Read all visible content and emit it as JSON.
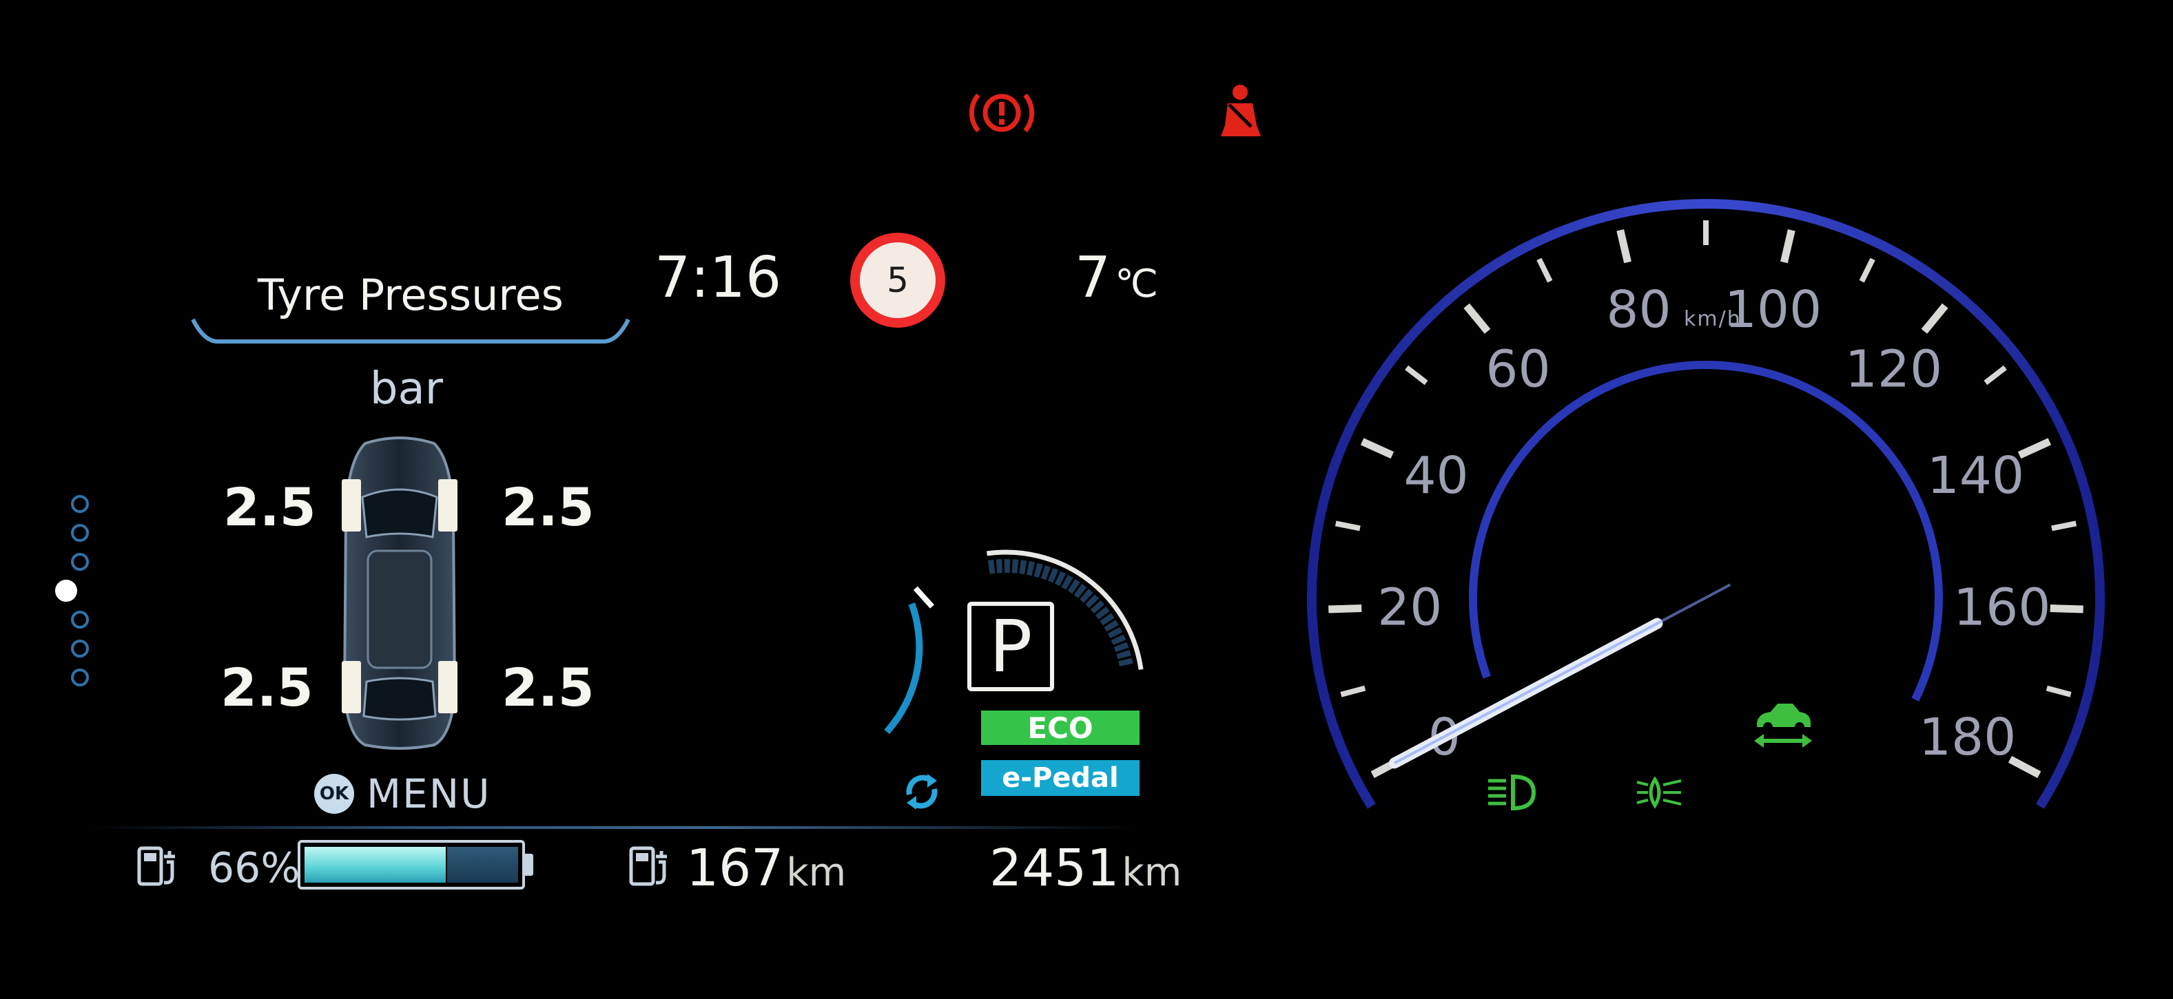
{
  "warnings": {
    "brake_icon": "brake-warning-icon",
    "seatbelt_icon": "seatbelt-warning-icon",
    "color": "#e2231a"
  },
  "tyre_panel": {
    "title": "Tyre Pressures",
    "unit": "bar",
    "front_left": "2.5",
    "front_right": "2.5",
    "rear_left": "2.5",
    "rear_right": "2.5",
    "pages_total": 7,
    "active_page": 4
  },
  "menu": {
    "ok_label": "OK",
    "label": "MENU"
  },
  "clock": "7:16",
  "speed_limit_sign": "5",
  "temperature": {
    "value": "7",
    "unit": "℃"
  },
  "drive": {
    "gear": "P",
    "mode_eco": "ECO",
    "mode_pedal": "e-Pedal",
    "eco_color": "#35c44a",
    "pedal_color": "#14a6cf"
  },
  "battery": {
    "percent_text": "66%",
    "level": 0.66
  },
  "range": {
    "value": "167",
    "unit": "km"
  },
  "odometer": {
    "value": "2451",
    "unit": "km"
  },
  "speedometer": {
    "unit": "km/h",
    "labels": [
      "0",
      "20",
      "40",
      "60",
      "80",
      "100",
      "120",
      "140",
      "160",
      "180"
    ],
    "min": 0,
    "max": 180,
    "current_speed": 0,
    "accent_color": "#2a38b8"
  },
  "indicator_lamps": {
    "headlight_icon": "headlight-icon",
    "foglight_icon": "front-fog-light-icon",
    "stability_icon": "vehicle-stability-icon",
    "color": "#3fbf3f"
  }
}
